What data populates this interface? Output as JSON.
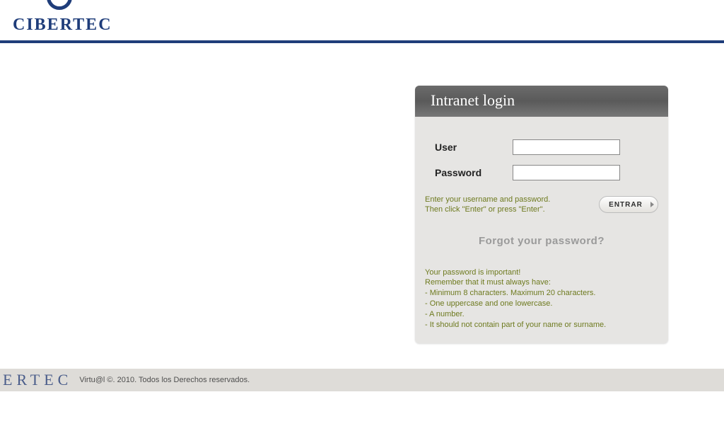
{
  "brand": {
    "name": "CIBERTEC"
  },
  "login": {
    "title": "Intranet login",
    "user_label": "User",
    "password_label": "Password",
    "user_value": "",
    "password_value": "",
    "hint_line1": "Enter your username and password.",
    "hint_line2": "Then click \"Enter\" or press \"Enter\".",
    "submit_label": "ENTRAR",
    "forgot_label": "Forgot your password?",
    "rules_heading": "Your password is important!",
    "rules_sub": "Remember that it must always have:",
    "rules": [
      "- Minimum 8 characters. Maximum 20 characters.",
      "- One uppercase and one lowercase.",
      "- A number.",
      "- It should not contain part of your name or surname."
    ]
  },
  "footer": {
    "brand_fragment": "ERTEC",
    "copyright": "Virtu@l ©. 2010. Todos los Derechos reservados."
  }
}
